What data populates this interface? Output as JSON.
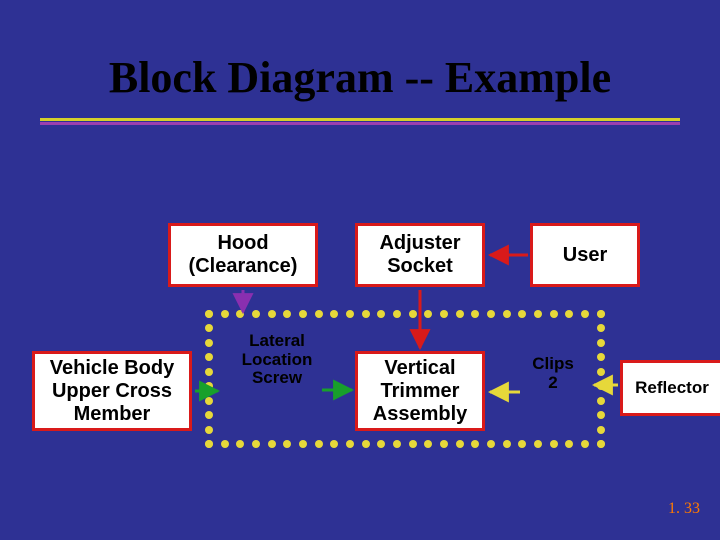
{
  "title": "Block Diagram -- Example",
  "boxes": {
    "hood": "Hood\n(Clearance)",
    "adjuster": "Adjuster\nSocket",
    "user": "User",
    "vehicle": "Vehicle Body\nUpper Cross\nMember",
    "vertical": "Vertical\nTrimmer\nAssembly",
    "reflector": "Reflector"
  },
  "labels": {
    "lateral": "Lateral\nLocation\nScrew",
    "clips": "Clips\n2"
  },
  "footer": "1. 33",
  "colors": {
    "bg": "#2e3194",
    "box_border": "#d91a1a",
    "dot": "#e6d83a",
    "arrow_red": "#d91a1a",
    "arrow_green": "#18a02b",
    "arrow_yellow": "#e6d83a",
    "arrow_purple": "#8a2fb0",
    "underline1": "#d6d12a",
    "underline2": "#9b3fb0",
    "footer": "#ff7a00"
  }
}
